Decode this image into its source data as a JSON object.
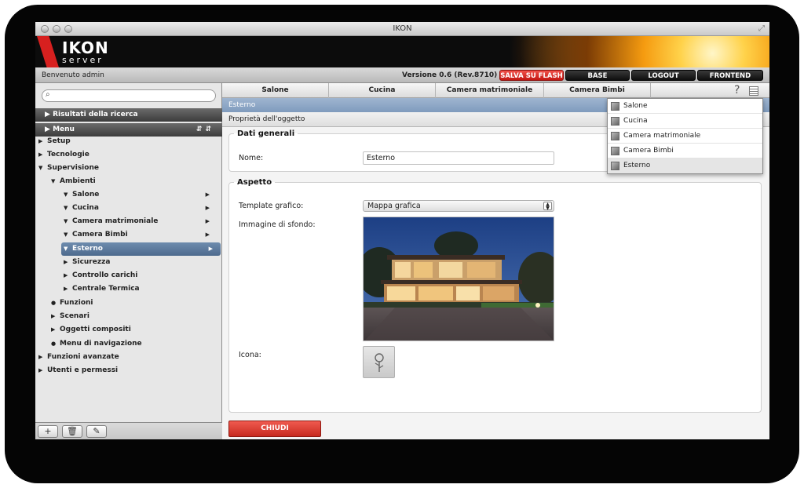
{
  "window": {
    "title": "IKON"
  },
  "brand": {
    "logo_top": "IKON",
    "logo_bottom": "server"
  },
  "statusbar": {
    "welcome": "Benvenuto admin",
    "version": "Versione 0.6 (Rev.8710)",
    "buttons": {
      "save_flash": "SALVA SU FLASH",
      "base": "BASE",
      "logout": "LOGOUT",
      "frontend": "FRONTEND"
    }
  },
  "sidebar": {
    "search_placeholder": "",
    "results_header": "Risultati della ricerca",
    "menu_header": "Menu",
    "tree": [
      {
        "label": "Setup",
        "arrow": "▶"
      },
      {
        "label": "Tecnologie",
        "arrow": "▶"
      },
      {
        "label": "Supervisione",
        "arrow": "▼"
      },
      {
        "label": "Ambienti",
        "arrow": "▼"
      },
      {
        "label": "Salone",
        "arrow": "▼"
      },
      {
        "label": "Cucina",
        "arrow": "▼"
      },
      {
        "label": "Camera matrimoniale",
        "arrow": "▼"
      },
      {
        "label": "Camera Bimbi",
        "arrow": "▼"
      },
      {
        "label": "Esterno",
        "arrow": "▼"
      },
      {
        "label": "Sicurezza",
        "arrow": "▶"
      },
      {
        "label": "Controllo carichi",
        "arrow": "▶"
      },
      {
        "label": "Centrale Termica",
        "arrow": "▶"
      },
      {
        "label": "Funzioni",
        "arrow": "●"
      },
      {
        "label": "Scenari",
        "arrow": "▶"
      },
      {
        "label": "Oggetti compositi",
        "arrow": "▶"
      },
      {
        "label": "Menu di navigazione",
        "arrow": "●"
      },
      {
        "label": "Funzioni avanzate",
        "arrow": "▶"
      },
      {
        "label": "Utenti e permessi",
        "arrow": "▶"
      }
    ],
    "footer": {
      "add": "+",
      "delete": "🗑",
      "edit": "✎"
    }
  },
  "main": {
    "tabs": [
      "Salone",
      "Cucina",
      "Camera matrimoniale",
      "Camera Bimbi"
    ],
    "help": "?",
    "breadcrumb": "Esterno",
    "section_title": "Proprietà dell'oggetto",
    "general": {
      "legend": "Dati generali",
      "name_label": "Nome:",
      "name_value": "Esterno"
    },
    "appearance": {
      "legend": "Aspetto",
      "template_label": "Template grafico:",
      "template_value": "Mappa grafica",
      "background_label": "Immagine di sfondo:",
      "icon_label": "Icona:"
    },
    "close_button": "CHIUDI"
  },
  "dropdown": {
    "items": [
      "Salone",
      "Cucina",
      "Camera matrimoniale",
      "Camera Bimbi",
      "Esterno"
    ],
    "active": "Esterno"
  },
  "colors": {
    "accent_red": "#d7201f",
    "selection_blue": "#5a7799",
    "header_blue": "#8ea7c6"
  }
}
